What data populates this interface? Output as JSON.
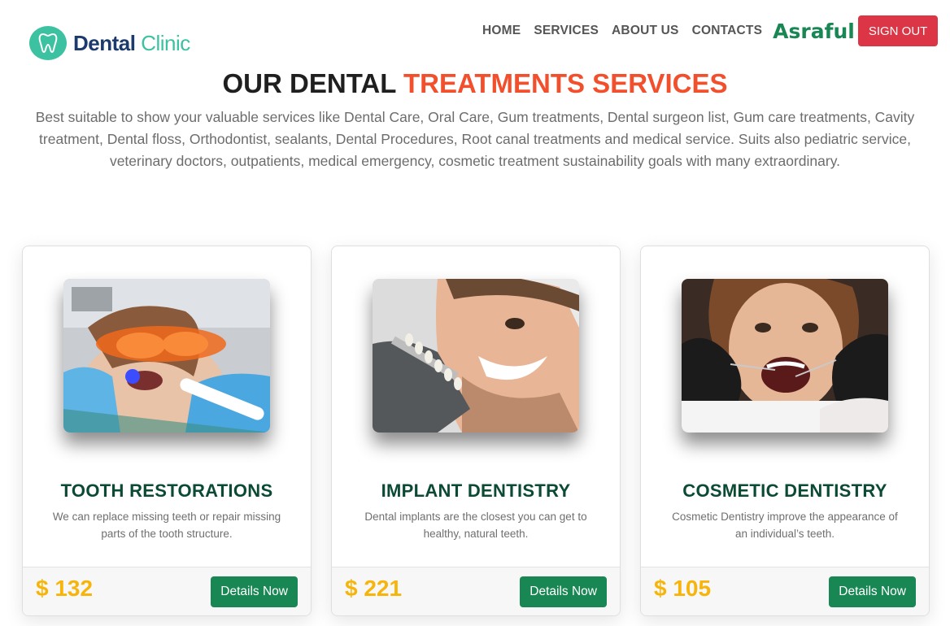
{
  "brand": {
    "name_bold": "Dental",
    "name_light": "Clinic",
    "icon": "tooth-logo-icon"
  },
  "nav": {
    "items": [
      {
        "label": "HOME"
      },
      {
        "label": "SERVICES"
      },
      {
        "label": "ABOUT US"
      },
      {
        "label": "CONTACTS"
      }
    ],
    "user_name": "Asraful",
    "signout_label": "SIGN OUT"
  },
  "section": {
    "title_dark": "OUR DENTAL",
    "title_accent": "TREATMENTS SERVICES",
    "description": "Best suitable to show your valuable services like Dental Care, Oral Care, Gum treatments, Dental surgeon list, Gum care treatments, Cavity treatment, Dental floss, Orthodontist, sealants, Dental Procedures, Root canal treatments and medical service. Suits also pediatric service, veterinary doctors, outpatients, medical emergency, cosmetic treatment sustainability goals with many extraordinary."
  },
  "services": [
    {
      "title": "TOOTH RESTORATIONS",
      "description": "We can replace missing teeth or repair missing parts of the tooth structure.",
      "price": "$ 132",
      "button": "Details Now"
    },
    {
      "title": "IMPLANT DENTISTRY",
      "description": "Dental implants are the closest you can get to healthy, natural teeth.",
      "price": "$ 221",
      "button": "Details Now"
    },
    {
      "title": "COSMETIC DENTISTRY",
      "description": "Cosmetic Dentistry improve the appearance of an individual’s teeth.",
      "price": "$ 105",
      "button": "Details Now"
    }
  ],
  "colors": {
    "brand_teal": "#3cc1a1",
    "brand_navy": "#1c3a6b",
    "accent_orange": "#f24f2c",
    "green": "#198754",
    "red": "#dc3545",
    "price_gold": "#f7b50c"
  }
}
